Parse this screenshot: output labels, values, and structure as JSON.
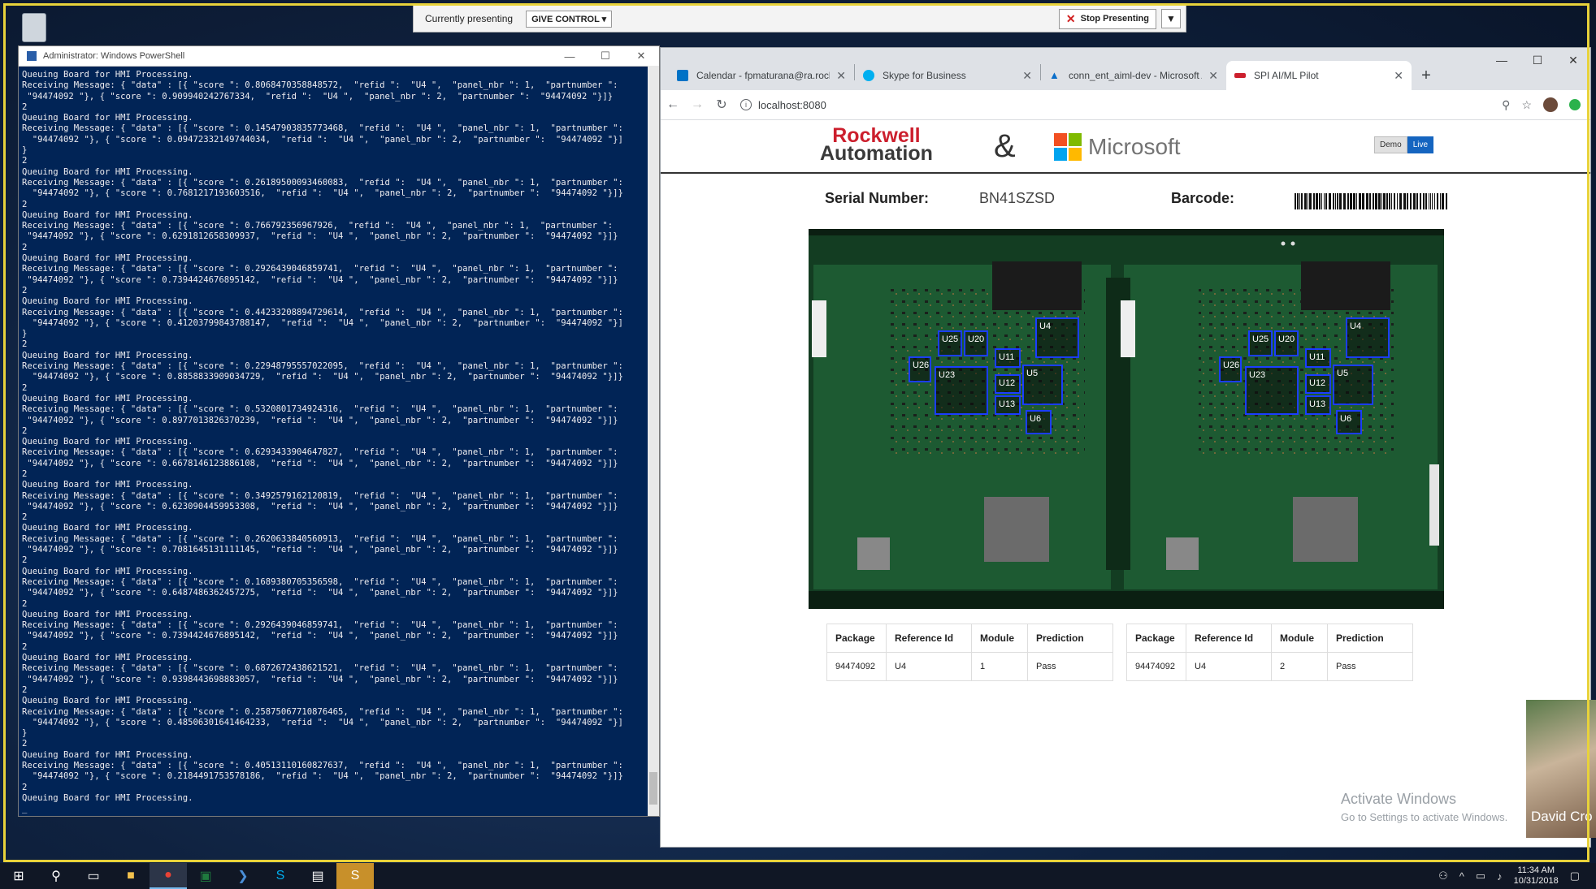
{
  "presenting_bar": {
    "currently_label": "Currently presenting",
    "give_control": "GIVE CONTROL ▾",
    "stop_presenting": "Stop Presenting",
    "pin": "📌"
  },
  "powershell": {
    "title": "Administrator: Windows PowerShell",
    "lines": [
      "Queuing Board for HMI Processing.",
      "Receiving Message: { \"data\" : [{ \"score \": 0.8068470358848572,  \"refid \":  \"U4 \",  \"panel_nbr \": 1,  \"partnumber \":",
      " \"94474092 \"}, { \"score \": 0.909940242767334,  \"refid \":  \"U4 \",  \"panel_nbr \": 2,  \"partnumber \":  \"94474092 \"}]}",
      "2",
      "Queuing Board for HMI Processing.",
      "Receiving Message: { \"data\" : [{ \"score \": 0.14547903835773468,  \"refid \":  \"U4 \",  \"panel_nbr \": 1,  \"partnumber \":",
      "  \"94474092 \"}, { \"score \": 0.09472332149744034,  \"refid \":  \"U4 \",  \"panel_nbr \": 2,  \"partnumber \":  \"94474092 \"}]",
      "}",
      "2",
      "Queuing Board for HMI Processing.",
      "Receiving Message: { \"data\" : [{ \"score \": 0.26189500093460083,  \"refid \":  \"U4 \",  \"panel_nbr \": 1,  \"partnumber \":",
      "  \"94474092 \"}, { \"score \": 0.7681217193603516,  \"refid \":  \"U4 \",  \"panel_nbr \": 2,  \"partnumber \":  \"94474092 \"}]}",
      "2",
      "Queuing Board for HMI Processing.",
      "Receiving Message: { \"data\" : [{ \"score \": 0.766792356967926,  \"refid \":  \"U4 \",  \"panel_nbr \": 1,  \"partnumber \":",
      " \"94474092 \"}, { \"score \": 0.6291812658309937,  \"refid \":  \"U4 \",  \"panel_nbr \": 2,  \"partnumber \":  \"94474092 \"}]}",
      "2",
      "Queuing Board for HMI Processing.",
      "Receiving Message: { \"data\" : [{ \"score \": 0.2926439046859741,  \"refid \":  \"U4 \",  \"panel_nbr \": 1,  \"partnumber \":",
      " \"94474092 \"}, { \"score \": 0.7394424676895142,  \"refid \":  \"U4 \",  \"panel_nbr \": 2,  \"partnumber \":  \"94474092 \"}]}",
      "2",
      "Queuing Board for HMI Processing.",
      "Receiving Message: { \"data\" : [{ \"score \": 0.44233208894729614,  \"refid \":  \"U4 \",  \"panel_nbr \": 1,  \"partnumber \":",
      "  \"94474092 \"}, { \"score \": 0.41203799843788147,  \"refid \":  \"U4 \",  \"panel_nbr \": 2,  \"partnumber \":  \"94474092 \"}]",
      "}",
      "2",
      "Queuing Board for HMI Processing.",
      "Receiving Message: { \"data\" : [{ \"score \": 0.22948795557022095,  \"refid \":  \"U4 \",  \"panel_nbr \": 1,  \"partnumber \":",
      "  \"94474092 \"}, { \"score \": 0.8858833909034729,  \"refid \":  \"U4 \",  \"panel_nbr \": 2,  \"partnumber \":  \"94474092 \"}]}",
      "2",
      "Queuing Board for HMI Processing.",
      "Receiving Message: { \"data\" : [{ \"score \": 0.5320801734924316,  \"refid \":  \"U4 \",  \"panel_nbr \": 1,  \"partnumber \":",
      " \"94474092 \"}, { \"score \": 0.8977013826370239,  \"refid \":  \"U4 \",  \"panel_nbr \": 2,  \"partnumber \":  \"94474092 \"}]}",
      "2",
      "Queuing Board for HMI Processing.",
      "Receiving Message: { \"data\" : [{ \"score \": 0.6293433904647827,  \"refid \":  \"U4 \",  \"panel_nbr \": 1,  \"partnumber \":",
      " \"94474092 \"}, { \"score \": 0.6678146123886108,  \"refid \":  \"U4 \",  \"panel_nbr \": 2,  \"partnumber \":  \"94474092 \"}]}",
      "2",
      "Queuing Board for HMI Processing.",
      "Receiving Message: { \"data\" : [{ \"score \": 0.3492579162120819,  \"refid \":  \"U4 \",  \"panel_nbr \": 1,  \"partnumber \":",
      " \"94474092 \"}, { \"score \": 0.6230904459953308,  \"refid \":  \"U4 \",  \"panel_nbr \": 2,  \"partnumber \":  \"94474092 \"}]}",
      "2",
      "Queuing Board for HMI Processing.",
      "Receiving Message: { \"data\" : [{ \"score \": 0.2620633840560913,  \"refid \":  \"U4 \",  \"panel_nbr \": 1,  \"partnumber \":",
      " \"94474092 \"}, { \"score \": 0.7081645131111145,  \"refid \":  \"U4 \",  \"panel_nbr \": 2,  \"partnumber \":  \"94474092 \"}]}",
      "2",
      "Queuing Board for HMI Processing.",
      "Receiving Message: { \"data\" : [{ \"score \": 0.1689380705356598,  \"refid \":  \"U4 \",  \"panel_nbr \": 1,  \"partnumber \":",
      " \"94474092 \"}, { \"score \": 0.6487486362457275,  \"refid \":  \"U4 \",  \"panel_nbr \": 2,  \"partnumber \":  \"94474092 \"}]}",
      "2",
      "Queuing Board for HMI Processing.",
      "Receiving Message: { \"data\" : [{ \"score \": 0.2926439046859741,  \"refid \":  \"U4 \",  \"panel_nbr \": 1,  \"partnumber \":",
      " \"94474092 \"}, { \"score \": 0.7394424676895142,  \"refid \":  \"U4 \",  \"panel_nbr \": 2,  \"partnumber \":  \"94474092 \"}]}",
      "2",
      "Queuing Board for HMI Processing.",
      "Receiving Message: { \"data\" : [{ \"score \": 0.6872672438621521,  \"refid \":  \"U4 \",  \"panel_nbr \": 1,  \"partnumber \":",
      " \"94474092 \"}, { \"score \": 0.9398443698883057,  \"refid \":  \"U4 \",  \"panel_nbr \": 2,  \"partnumber \":  \"94474092 \"}]}",
      "2",
      "Queuing Board for HMI Processing.",
      "Receiving Message: { \"data\" : [{ \"score \": 0.25875067710876465,  \"refid \":  \"U4 \",  \"panel_nbr \": 1,  \"partnumber \":",
      "  \"94474092 \"}, { \"score \": 0.48506301641464233,  \"refid \":  \"U4 \",  \"panel_nbr \": 2,  \"partnumber \":  \"94474092 \"}]",
      "}",
      "2",
      "Queuing Board for HMI Processing.",
      "Receiving Message: { \"data\" : [{ \"score \": 0.40513110160827637,  \"refid \":  \"U4 \",  \"panel_nbr \": 1,  \"partnumber \":",
      "  \"94474092 \"}, { \"score \": 0.2184491753578186,  \"refid \":  \"U4 \",  \"panel_nbr \": 2,  \"partnumber \":  \"94474092 \"}]}",
      "2",
      "Queuing Board for HMI Processing.",
      "_"
    ]
  },
  "browser": {
    "tabs": [
      {
        "title": "Calendar - fpmaturana@ra.rockw",
        "icon": "outlook-icon",
        "color": "#0072c6",
        "active": false
      },
      {
        "title": "Skype for Business",
        "icon": "skype-icon",
        "color": "#00aff0",
        "active": false
      },
      {
        "title": "conn_ent_aiml-dev - Microsoft A",
        "icon": "azure-icon",
        "color": "#0a6ec9",
        "active": false
      },
      {
        "title": "SPI AI/ML Pilot",
        "icon": "rok-icon",
        "color": "#cc1f2d",
        "active": true
      }
    ],
    "new_tab": "+",
    "url": "localhost:8080"
  },
  "app": {
    "brand_rockwell_1": "Rockwell",
    "brand_rockwell_2": "Automation",
    "ampersand": "&",
    "brand_microsoft": "Microsoft",
    "mode_demo": "Demo",
    "mode_live": "Live",
    "serial_label": "Serial Number:",
    "serial_value": "BN41SZSD",
    "barcode_label": "Barcode:",
    "board_labels": [
      "U25",
      "U20",
      "U4",
      "U26",
      "U11",
      "U23",
      "U5",
      "U12",
      "U13",
      "U6"
    ],
    "columns": [
      "Package",
      "Reference Id",
      "Module",
      "Prediction"
    ],
    "tables": [
      {
        "rows": [
          [
            "94474092",
            "U4",
            "1",
            "Pass"
          ]
        ]
      },
      {
        "rows": [
          [
            "94474092",
            "U4",
            "2",
            "Pass"
          ]
        ]
      }
    ]
  },
  "overlay": {
    "activate_title": "Activate Windows",
    "activate_sub": "Go to Settings to activate Windows.",
    "webcam_name": "David Cro"
  },
  "taskbar": {
    "time": "11:34 AM",
    "date": "10/31/2018"
  },
  "colors": {
    "ps_background": "#012456",
    "accent_live": "#1565c0",
    "detection_box": "#1b3dff",
    "rockwell_red": "#cc1f2d"
  }
}
